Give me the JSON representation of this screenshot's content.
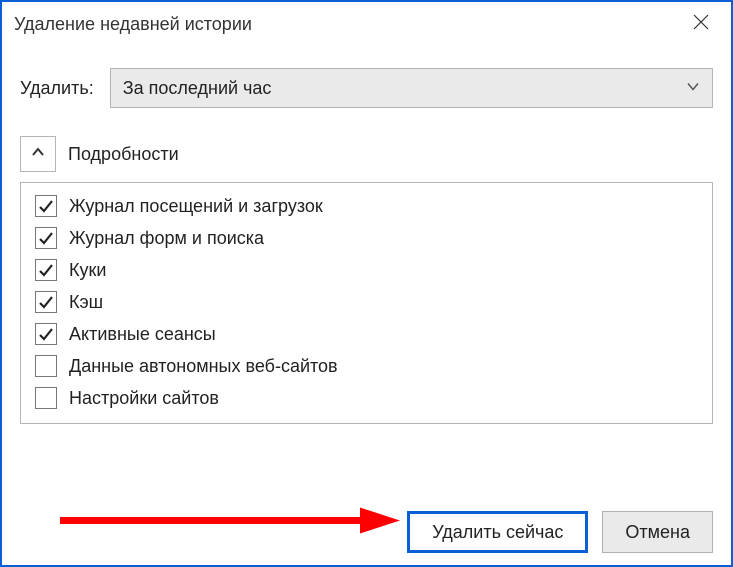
{
  "window": {
    "title": "Удаление недавней истории"
  },
  "deleteRow": {
    "label": "Удалить:",
    "selected": "За последний час"
  },
  "details": {
    "label": "Подробности",
    "items": [
      {
        "label": "Журнал посещений и загрузок",
        "checked": true
      },
      {
        "label": "Журнал форм и поиска",
        "checked": true
      },
      {
        "label": "Куки",
        "checked": true
      },
      {
        "label": "Кэш",
        "checked": true
      },
      {
        "label": "Активные сеансы",
        "checked": true
      },
      {
        "label": "Данные автономных веб-сайтов",
        "checked": false
      },
      {
        "label": "Настройки сайтов",
        "checked": false
      }
    ]
  },
  "buttons": {
    "deleteNow": "Удалить сейчас",
    "cancel": "Отмена"
  },
  "colors": {
    "accent": "#0a5ed6",
    "arrow": "#ff0000"
  }
}
